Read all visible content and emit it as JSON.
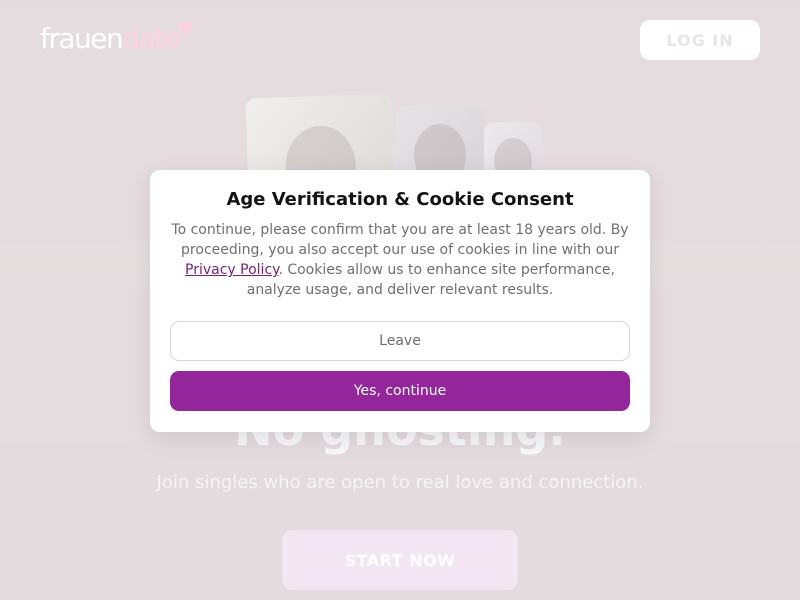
{
  "header": {
    "logo_part1": "frauen",
    "logo_part2": "date",
    "login_label": "LOG IN"
  },
  "hero": {
    "headline": "No ghosting.",
    "subline": "Join singles who are open to real love and connection.",
    "cta_label": "START NOW"
  },
  "modal": {
    "title": "Age Verification & Cookie Consent",
    "text_before_link": "To continue, please confirm that you are at least 18 years old. By proceeding, you also accept our use of cookies in line with our ",
    "link_label": "Privacy Policy",
    "text_after_link": ". Cookies allow us to enhance site performance, analyze usage, and deliver relevant results.",
    "leave_label": "Leave",
    "continue_label": "Yes, continue"
  },
  "colors": {
    "accent": "#93269a",
    "logo_pink": "#ffd1e3",
    "link": "#7b1d7a"
  },
  "icons": {
    "logo_heart": "heart-icon"
  }
}
